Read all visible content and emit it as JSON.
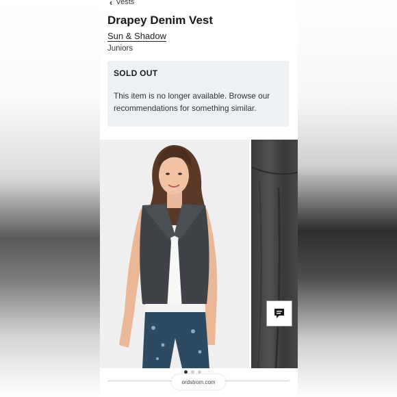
{
  "breadcrumb": {
    "label": "Vests"
  },
  "product": {
    "title": "Drapey Denim Vest",
    "brand": "Sun & Shadow",
    "department": "Juniors"
  },
  "sold_out": {
    "heading": "SOLD OUT",
    "message": "This item is no longer available. Browse our recommendations for something similar."
  },
  "gallery": {
    "image_count": 3,
    "active_index": 0
  },
  "browser": {
    "url": "ordstrom.com"
  },
  "icons": {
    "back": "chevron-left-icon",
    "chat": "chat-bubble-icon"
  },
  "colors": {
    "text": "#1a1a1a",
    "notice_bg": "#eef1f4"
  }
}
